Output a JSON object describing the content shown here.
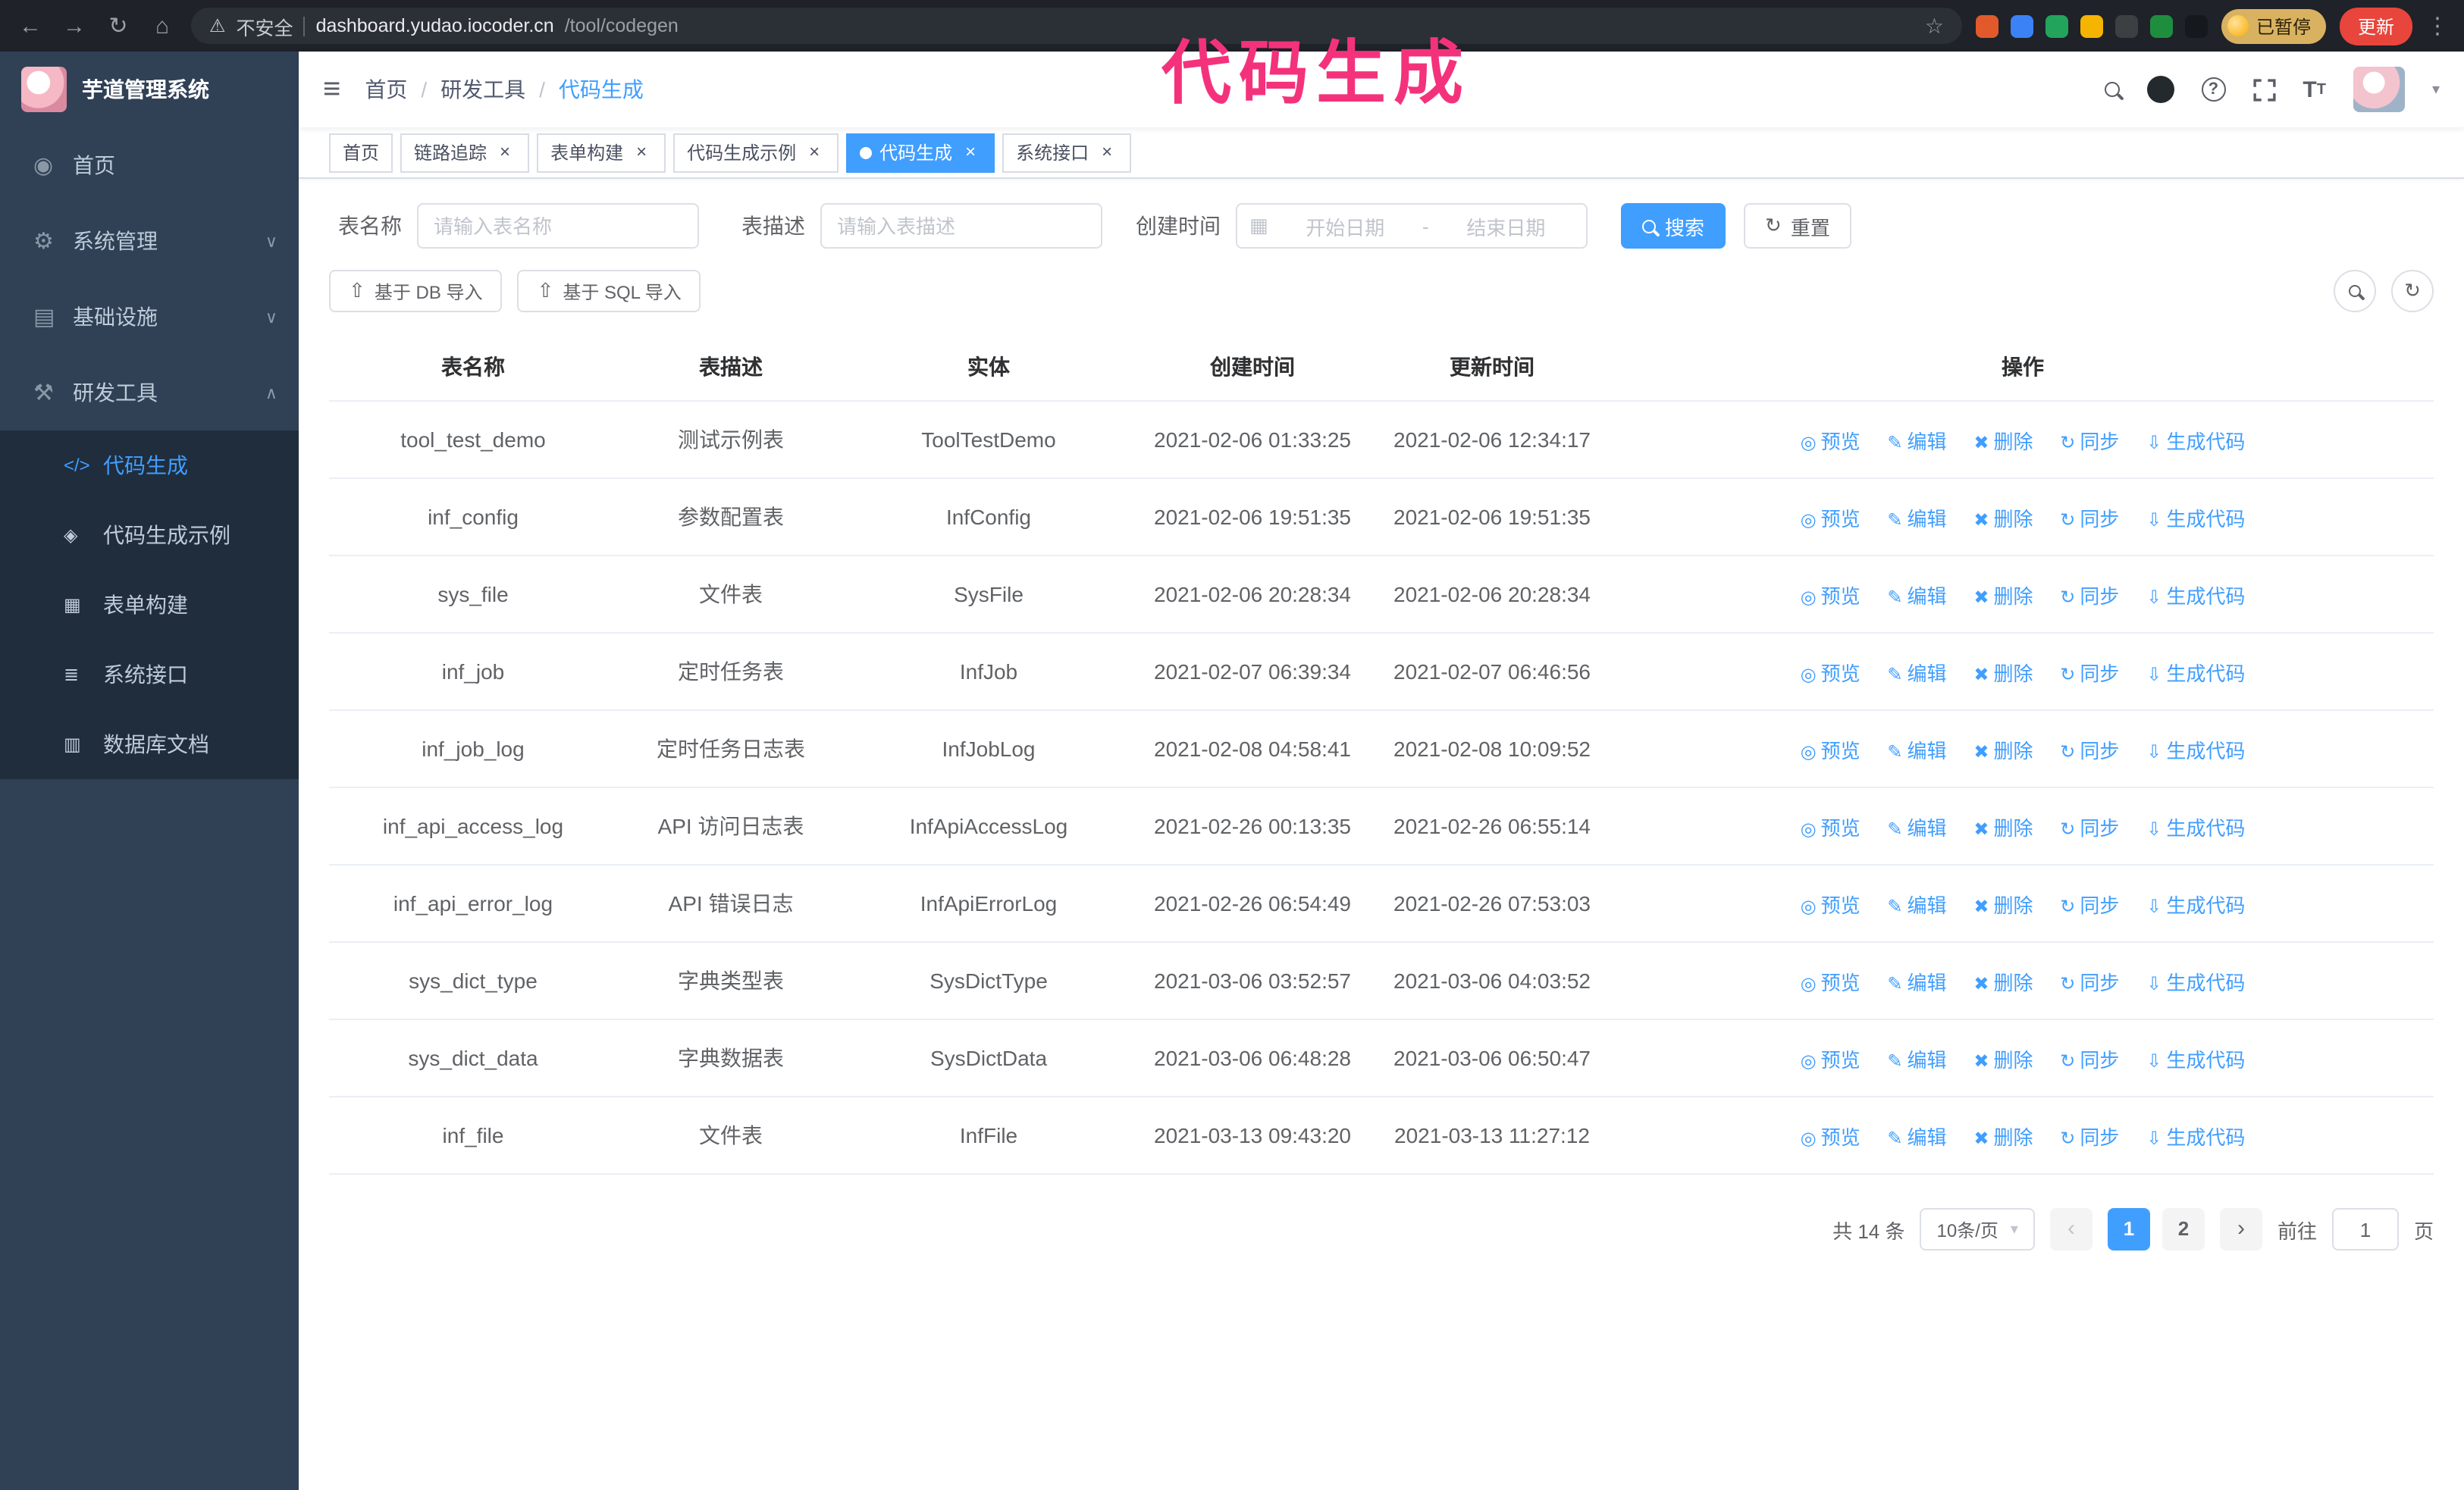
{
  "browser": {
    "url_security": "不安全",
    "url_host": "dashboard.yudao.iocoder.cn",
    "url_path": "/tool/codegen",
    "paused_badge": "已暂停",
    "update_button": "更新",
    "extensions": [
      {
        "name": "extension-orange",
        "color": "#e25a2b"
      },
      {
        "name": "extension-blue-drop",
        "color": "#3b82f6"
      },
      {
        "name": "extension-green-check",
        "color": "#22a45d"
      },
      {
        "name": "extension-people",
        "color": "#f4b400"
      },
      {
        "name": "extension-dark",
        "color": "#3c4043"
      },
      {
        "name": "extension-leaf",
        "color": "#1e8e3e"
      },
      {
        "name": "extension-puzzle",
        "color": "#15181c"
      }
    ]
  },
  "annotation": "代码生成",
  "icons": {
    "back": "←",
    "forward": "→",
    "reload": "↻",
    "home": "⌂",
    "warning": "⚠",
    "star": "☆",
    "menu_kebab": "⋮",
    "hamburger": "≡",
    "calendar": "▦",
    "upload": "⇧",
    "refresh": "↻",
    "caret_down": "▾",
    "question": "?",
    "font_large": "T",
    "font_small": "T",
    "prev": "‹",
    "next": "›",
    "close": "×"
  },
  "sidebar": {
    "logo_title": "芋道管理系统",
    "items": [
      {
        "label": "首页",
        "icon": "home-icon",
        "glyph": "◉",
        "chevron": ""
      },
      {
        "label": "系统管理",
        "icon": "gear-icon",
        "glyph": "⚙",
        "chevron": "∨"
      },
      {
        "label": "基础设施",
        "icon": "infrastructure-icon",
        "glyph": "▤",
        "chevron": "∨"
      },
      {
        "label": "研发工具",
        "icon": "tools-icon",
        "glyph": "⚒",
        "chevron": "∧",
        "expanded": true
      }
    ],
    "subitems": [
      {
        "label": "代码生成",
        "icon": "code-icon",
        "glyph": "</>",
        "active": true
      },
      {
        "label": "代码生成示例",
        "icon": "example-icon",
        "glyph": "◈"
      },
      {
        "label": "表单构建",
        "icon": "form-builder-icon",
        "glyph": "▦"
      },
      {
        "label": "系统接口",
        "icon": "api-icon",
        "glyph": "≣"
      },
      {
        "label": "数据库文档",
        "icon": "database-doc-icon",
        "glyph": "▥"
      }
    ]
  },
  "header": {
    "breadcrumb": [
      "首页",
      "研发工具",
      "代码生成"
    ]
  },
  "tabs": [
    {
      "label": "首页",
      "closable": false,
      "active": false
    },
    {
      "label": "链路追踪",
      "closable": true,
      "active": false
    },
    {
      "label": "表单构建",
      "closable": true,
      "active": false
    },
    {
      "label": "代码生成示例",
      "closable": true,
      "active": false
    },
    {
      "label": "代码生成",
      "closable": true,
      "active": true
    },
    {
      "label": "系统接口",
      "closable": true,
      "active": false
    }
  ],
  "filters": {
    "table_name_label": "表名称",
    "table_name_placeholder": "请输入表名称",
    "table_desc_label": "表描述",
    "table_desc_placeholder": "请输入表描述",
    "create_time_label": "创建时间",
    "date_start_placeholder": "开始日期",
    "date_separator": "-",
    "date_end_placeholder": "结束日期",
    "search_button": "搜索",
    "reset_button": "重置"
  },
  "toolbar": {
    "import_db": "基于 DB 导入",
    "import_sql": "基于 SQL 导入"
  },
  "table": {
    "columns": [
      "表名称",
      "表描述",
      "实体",
      "创建时间",
      "更新时间",
      "操作"
    ],
    "actions": [
      "预览",
      "编辑",
      "删除",
      "同步",
      "生成代码"
    ],
    "action_icons": {
      "preview": "◎",
      "edit": "✎",
      "delete": "✖",
      "sync": "↻",
      "generate": "⇩"
    },
    "rows": [
      {
        "name": "tool_test_demo",
        "desc": "测试示例表",
        "entity": "ToolTestDemo",
        "created": "2021-02-06 01:33:25",
        "updated": "2021-02-06 12:34:17"
      },
      {
        "name": "inf_config",
        "desc": "参数配置表",
        "entity": "InfConfig",
        "created": "2021-02-06 19:51:35",
        "updated": "2021-02-06 19:51:35"
      },
      {
        "name": "sys_file",
        "desc": "文件表",
        "entity": "SysFile",
        "created": "2021-02-06 20:28:34",
        "updated": "2021-02-06 20:28:34"
      },
      {
        "name": "inf_job",
        "desc": "定时任务表",
        "entity": "InfJob",
        "created": "2021-02-07 06:39:34",
        "updated": "2021-02-07 06:46:56"
      },
      {
        "name": "inf_job_log",
        "desc": "定时任务日志表",
        "entity": "InfJobLog",
        "created": "2021-02-08 04:58:41",
        "updated": "2021-02-08 10:09:52"
      },
      {
        "name": "inf_api_access_log",
        "desc": "API 访问日志表",
        "entity": "InfApiAccessLog",
        "created": "2021-02-26 00:13:35",
        "updated": "2021-02-26 06:55:14"
      },
      {
        "name": "inf_api_error_log",
        "desc": "API 错误日志",
        "entity": "InfApiErrorLog",
        "created": "2021-02-26 06:54:49",
        "updated": "2021-02-26 07:53:03"
      },
      {
        "name": "sys_dict_type",
        "desc": "字典类型表",
        "entity": "SysDictType",
        "created": "2021-03-06 03:52:57",
        "updated": "2021-03-06 04:03:52"
      },
      {
        "name": "sys_dict_data",
        "desc": "字典数据表",
        "entity": "SysDictData",
        "created": "2021-03-06 06:48:28",
        "updated": "2021-03-06 06:50:47"
      },
      {
        "name": "inf_file",
        "desc": "文件表",
        "entity": "InfFile",
        "created": "2021-03-13 09:43:20",
        "updated": "2021-03-13 11:27:12"
      }
    ]
  },
  "pagination": {
    "total": "共 14 条",
    "page_size": "10条/页",
    "pages": [
      {
        "label": "1",
        "active": true
      },
      {
        "label": "2",
        "active": false
      }
    ],
    "goto_label": "前往",
    "goto_value": "1",
    "goto_suffix": "页"
  },
  "colors": {
    "accent": "#409eff",
    "sidebar_bg": "#304156",
    "submenu_bg": "#1f2d3d",
    "tab_active_bg": "#409eff",
    "annotation": "#f4327c",
    "update_button_bg": "#e8453c",
    "paused_badge_bg": "#d9b261"
  }
}
